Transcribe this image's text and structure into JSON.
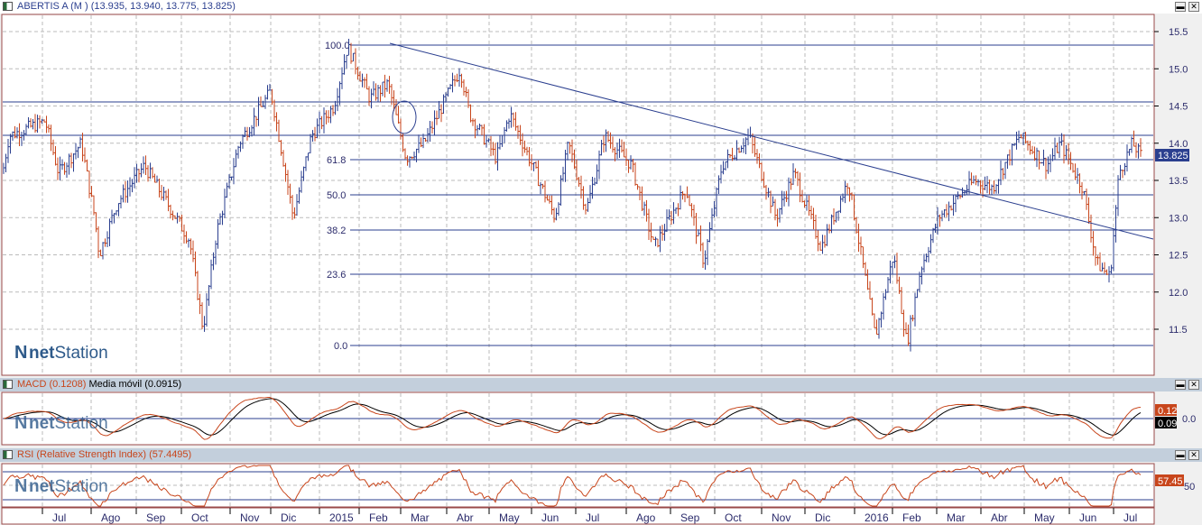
{
  "main": {
    "title": "ABERTIS A (M ) (13.935, 13.940, 13.775, 13.825)",
    "last_price": "13.825",
    "y_ticks": [
      "15.5",
      "15.0",
      "14.5",
      "14.0",
      "13.5",
      "13.0",
      "12.5",
      "12.0",
      "11.5"
    ],
    "fib_levels": [
      "100.0",
      "61.8",
      "50.0",
      "38.2",
      "23.6",
      "0.0"
    ],
    "logo": "netStation"
  },
  "macd": {
    "label": "MACD (0.1208)",
    "signal_label": "Media móvil (0.0915)",
    "macd_value": "0.12",
    "signal_value": "0.09",
    "zero_tick": "0.0"
  },
  "rsi": {
    "label": "RSI (Relative Strength Index) (57.4495)",
    "value": "57.45",
    "tick": "50"
  },
  "x_axis": [
    "Jul",
    "Ago",
    "Sep",
    "Oct",
    "Nov",
    "Dic",
    "2015",
    "Feb",
    "Mar",
    "Abr",
    "May",
    "Jun",
    "Jul",
    "Ago",
    "Sep",
    "Oct",
    "Nov",
    "Dic",
    "2016",
    "Feb",
    "Mar",
    "Abr",
    "May",
    "Jun",
    "Jul"
  ],
  "buttons": {
    "minimize": "▬",
    "close": "✕"
  },
  "colors": {
    "up": "#2b3f8f",
    "down": "#c8461c",
    "frame": "#9a4a4a",
    "pane_header": "#c3cfdc"
  }
}
